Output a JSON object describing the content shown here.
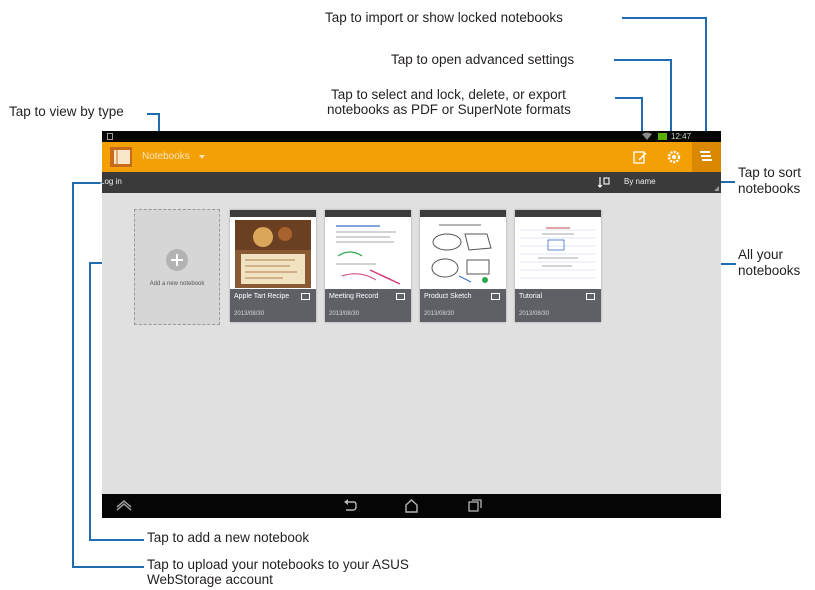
{
  "callouts": {
    "import": "Tap to import or show locked notebooks",
    "settings": "Tap to open advanced settings",
    "select_line1": "Tap to select and lock, delete, or export",
    "select_line2": "notebooks as PDF or SuperNote formats",
    "view_by_type": "Tap to view by type",
    "sort_line1": "Tap to sort",
    "sort_line2": "notebooks",
    "all_line1": "All your",
    "all_line2": "notebooks",
    "add": "Tap to add a new notebook",
    "upload_line1": "Tap to upload your notebooks to your ASUS",
    "upload_line2": "WebStorage account"
  },
  "statusbar": {
    "time": "12:47"
  },
  "actionbar": {
    "title": "Notebooks"
  },
  "toolbar": {
    "login": "Log in",
    "sort": "By name"
  },
  "add_notebook": {
    "label": "Add a new notebook"
  },
  "notebooks": [
    {
      "title": "Apple Tart Recipe",
      "date": "2013/08/30"
    },
    {
      "title": "Meeting Record",
      "date": "2013/08/30"
    },
    {
      "title": "Product Sketch",
      "date": "2013/08/30"
    },
    {
      "title": "Tutorial",
      "date": "2013/08/30"
    }
  ],
  "colors": {
    "accent": "#f3a006",
    "callout_line": "#1f6cb0",
    "dark_bar": "#3a3a3a"
  },
  "icons": [
    "app-notebook-icon",
    "dropdown-arrow-icon",
    "select-edit-icon",
    "settings-gear-icon",
    "menu-import-icon",
    "sort-icon",
    "plus-icon",
    "back-icon",
    "home-icon",
    "recent-apps-icon",
    "up-chevron-icon",
    "wifi-icon",
    "battery-icon"
  ]
}
